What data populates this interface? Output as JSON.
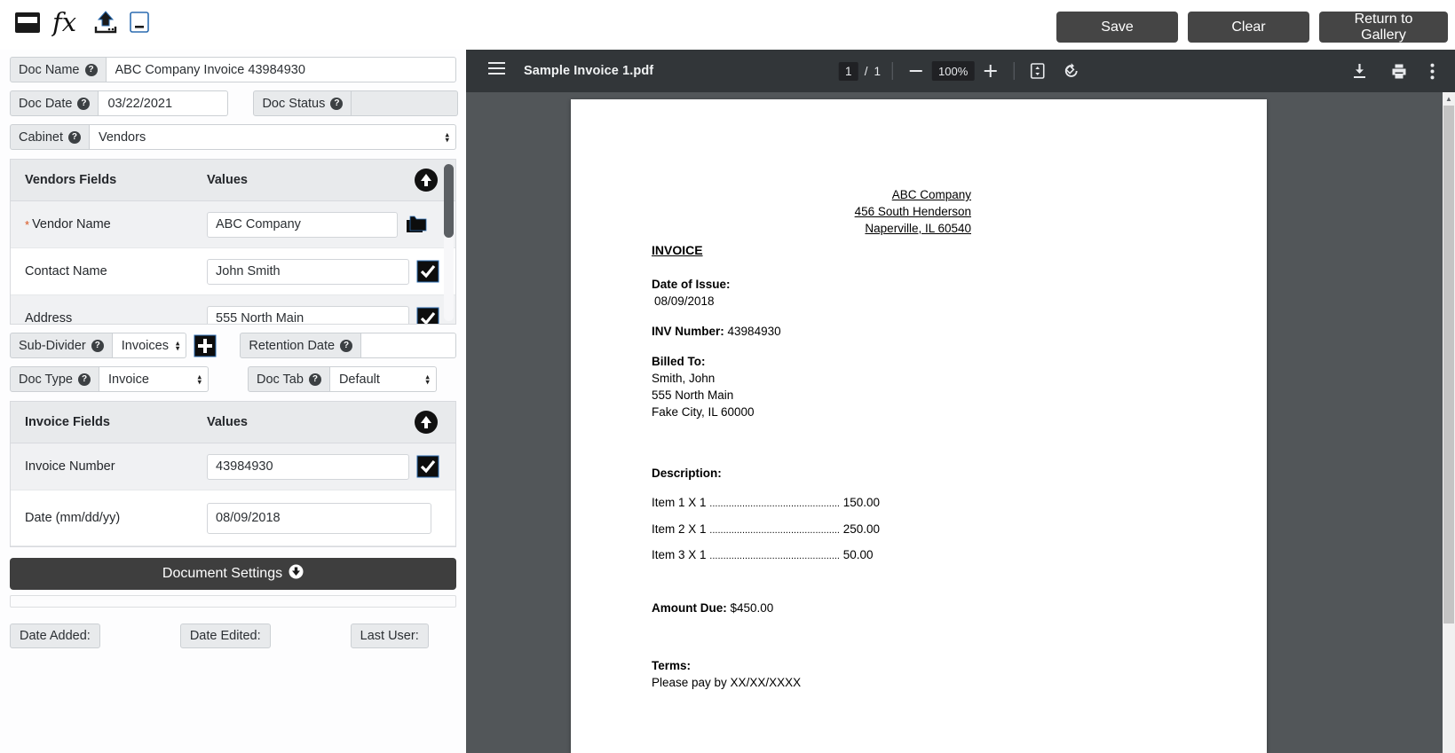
{
  "toolbar": {
    "icons": [
      {
        "name": "save-doc-icon",
        "title": "Save"
      },
      {
        "name": "fx-formula-icon",
        "title": "fx"
      },
      {
        "name": "upload-icon",
        "title": "Upload"
      },
      {
        "name": "window-minimize-icon",
        "title": "Window"
      }
    ],
    "save_label": "Save",
    "clear_label": "Clear",
    "return_label": "Return to Gallery"
  },
  "form": {
    "doc_name": {
      "label": "Doc Name",
      "value": "ABC Company Invoice 43984930"
    },
    "doc_date": {
      "label": "Doc Date",
      "value": "03/22/2021"
    },
    "doc_status": {
      "label": "Doc Status",
      "value": ""
    },
    "cabinet": {
      "label": "Cabinet",
      "value": "Vendors"
    },
    "sub_divider": {
      "label": "Sub-Divider",
      "value": "Invoices"
    },
    "retention_date": {
      "label": "Retention Date",
      "value": ""
    },
    "doc_type": {
      "label": "Doc Type",
      "value": "Invoice"
    },
    "doc_tab": {
      "label": "Doc Tab",
      "value": "Default"
    }
  },
  "vendors_table": {
    "header_fields": "Vendors Fields",
    "header_values": "Values",
    "rows": [
      {
        "label": "Vendor Name",
        "required": true,
        "value": "ABC Company",
        "icon": "folder-icon"
      },
      {
        "label": "Contact Name",
        "required": false,
        "value": "John Smith",
        "icon": "checkbox-checked-icon"
      },
      {
        "label": "Address",
        "required": false,
        "value": "555 North Main",
        "icon": "checkbox-checked-icon"
      }
    ]
  },
  "invoice_table": {
    "header_fields": "Invoice Fields",
    "header_values": "Values",
    "rows": [
      {
        "label": "Invoice Number",
        "value": "43984930",
        "icon": "checkbox-checked-icon"
      },
      {
        "label": "Date (mm/dd/yy)",
        "value": "08/09/2018",
        "icon": ""
      }
    ]
  },
  "document_settings": {
    "label": "Document Settings"
  },
  "footer": {
    "date_added": "Date Added:",
    "date_edited": "Date Edited:",
    "last_user": "Last User:"
  },
  "pdf": {
    "title": "Sample Invoice 1.pdf",
    "page_current": "1",
    "page_separator": "/",
    "page_total": "1",
    "zoom": "100%",
    "icons": {
      "menu": "hamburger-menu-icon",
      "zoom_out": "minus-icon",
      "zoom_in": "plus-icon",
      "fit": "fit-to-page-icon",
      "rotate": "rotate-icon",
      "download": "download-icon",
      "print": "print-icon",
      "more": "more-options-icon"
    }
  },
  "invoice_doc": {
    "company": [
      "ABC Company",
      "456 South Henderson",
      "Naperville, IL 60540"
    ],
    "title": "INVOICE",
    "date_of_issue_label": "Date of Issue:",
    "date_of_issue_value": "08/09/2018",
    "inv_number_label": "INV Number:",
    "inv_number_value": "43984930",
    "billed_to_label": "Billed To:",
    "billed_to": [
      "Smith, John",
      "555 North Main",
      "Fake City, IL 60000"
    ],
    "description_label": "Description:",
    "items": [
      {
        "text": "Item 1 X 1",
        "dots": "................................................",
        "amount": "150.00"
      },
      {
        "text": "Item 2 X 1",
        "dots": "................................................",
        "amount": "250.00"
      },
      {
        "text": "Item 3 X 1",
        "dots": "................................................",
        "amount": "50.00"
      }
    ],
    "amount_due_label": "Amount Due:",
    "amount_due_value": "$450.00",
    "terms_label": "Terms:",
    "terms_value": "Please pay by XX/XX/XXXX"
  },
  "colors": {
    "button_dark": "#454545",
    "pdf_chrome": "#323639",
    "pdf_backdrop": "#525659",
    "label_gray": "#e8eaec",
    "required_orange": "#d9541e"
  }
}
